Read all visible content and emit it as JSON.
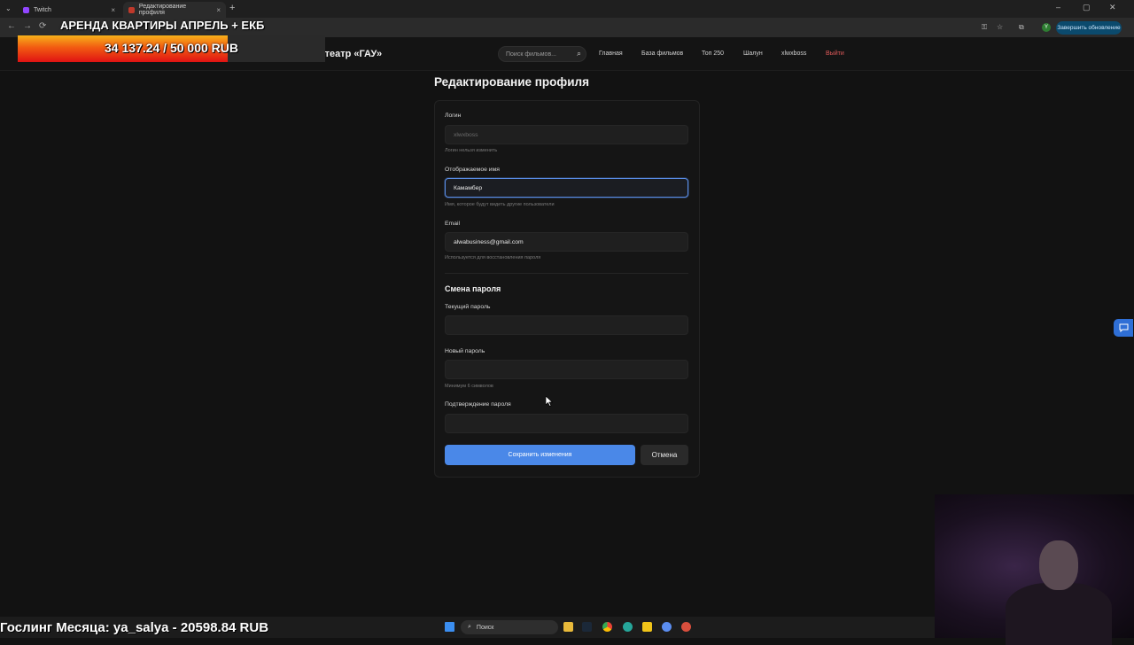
{
  "browser": {
    "tabs": [
      {
        "label": "Twitch",
        "close": "×"
      },
      {
        "label": "Редактирование профиля",
        "close": "×"
      }
    ],
    "new_tab": "+",
    "update_button": "Завершить обновление",
    "profile_initial": "Y",
    "window_controls": [
      "–",
      "▢",
      "✕"
    ],
    "nav": [
      "←",
      "→",
      "⟳"
    ]
  },
  "site": {
    "brand": "Кинотеатр «ГАУ»",
    "search_placeholder": "Поиск фильмов...",
    "nav": {
      "home": "Главная",
      "films": "База фильмов",
      "top": "Топ 250",
      "shalun": "Шалун",
      "user": "xlwxboss",
      "logout": "Выйти"
    }
  },
  "page": {
    "title": "Редактирование профиля",
    "login": {
      "label": "Логин",
      "value": "xlwxboss",
      "hint": "Логин нельзя изменить"
    },
    "display_name": {
      "label": "Отображаемое имя",
      "value": "Камамбер",
      "hint": "Имя, которое будут видеть другие пользователи"
    },
    "email": {
      "label": "Email",
      "value": "alwabusiness@gmail.com",
      "hint": "Используется для восстановления пароля"
    },
    "password_section": "Смена пароля",
    "current_password": {
      "label": "Текущий пароль",
      "value": ""
    },
    "new_password": {
      "label": "Новый пароль",
      "value": "",
      "hint": "Минимум 6 символов"
    },
    "confirm_password": {
      "label": "Подтверждение пароля",
      "value": ""
    },
    "save_button": "Сохранить изменения",
    "cancel_button": "Отмена"
  },
  "overlay": {
    "title": "АРЕНДА КВАРТИРЫ АПРЕЛЬ + ЕКБ",
    "donation_progress": "34 137.24 / 50 000 RUB",
    "donation_fraction": 0.6827,
    "gosling": "Гослинг Месяца: ya_salya - 20598.84 RUB"
  },
  "taskbar": {
    "search_label": "Поиск"
  },
  "colors": {
    "accent": "#4a88e8",
    "logout": "#e05a5a",
    "update": "#0b4a6d"
  }
}
